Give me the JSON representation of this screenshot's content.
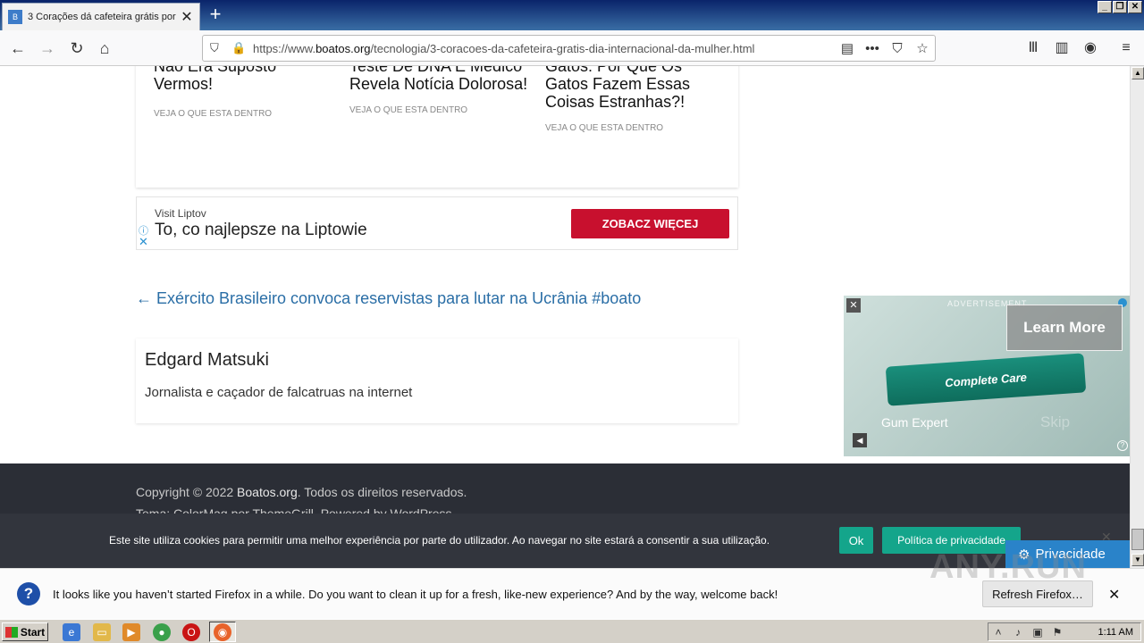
{
  "browser": {
    "tab_title": "3 Corações dá cafeteira grátis por",
    "url_prefix": "https://www.",
    "url_domain": "boatos.org",
    "url_path": "/tecnologia/3-coracoes-da-cafeteira-gratis-dia-internacional-da-mulher.html"
  },
  "related": [
    {
      "title": "Não Era Suposto Vermos!",
      "cta": "VEJA O QUE ESTA DENTRO"
    },
    {
      "title": "Teste De DNA E Médico Revela Notícia Dolorosa!",
      "cta": "VEJA O QUE ESTA DENTRO"
    },
    {
      "title": "Gatos: Por Que Os Gatos Fazem Essas Coisas Estranhas?!",
      "cta": "VEJA O QUE ESTA DENTRO"
    }
  ],
  "ad_banner": {
    "visit": "Visit Liptov",
    "headline": "To, co najlepsze na Liptowie",
    "cta": "ZOBACZ WIĘCEJ"
  },
  "prev_post": "← Exército Brasileiro convoca reservistas para lutar na Ucrânia #boato",
  "author": {
    "name": "Edgard Matsuki",
    "bio": "Jornalista e caçador de falcatruas na internet"
  },
  "video_ad": {
    "label": "ADVERTISEMENT",
    "learn_more": "Learn More",
    "product": "Complete Care",
    "tagline": "Gum Expert",
    "skip": "Skip"
  },
  "footer": {
    "copyright_prefix": "Copyright © 2022 ",
    "site_link": "Boatos.org",
    "copyright_suffix": ". Todos os direitos reservados.",
    "theme": "Tema: ColorMag por ThemeGrill. Powered by WordPress."
  },
  "cookie": {
    "text": "Este site utiliza cookies para permitir uma melhor experiência por parte do utilizador. Ao navegar no site estará a consentir a sua utilização.",
    "ok": "Ok",
    "privacy_policy": "Política de privacidade",
    "privacy_button": "Privacidade"
  },
  "notification": {
    "text": "It looks like you haven’t started Firefox in a while. Do you want to clean it up for a fresh, like-new experience? And by the way, welcome back!",
    "button": "Refresh Firefox…"
  },
  "watermark": "ANY.RUN",
  "taskbar": {
    "start": "Start",
    "time": "1:11 AM"
  }
}
